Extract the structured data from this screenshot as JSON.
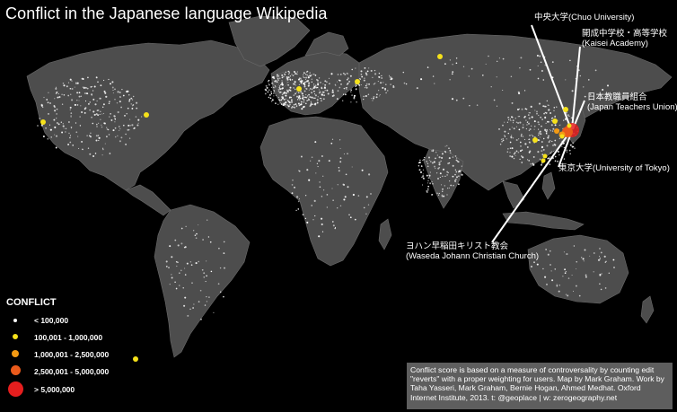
{
  "title": "Conflict in the Japanese language Wikipedia",
  "colors": {
    "background": "#000000",
    "land": "#4d4d4d",
    "borders": "#6f6f6f",
    "activity_dots": "#ffffff",
    "small": "#ffffff",
    "medium": "#f5e11a",
    "large": "#f39a13",
    "xlarge": "#ea5a1b",
    "max": "#e51e1e",
    "caption_bg": "#6e6e6e",
    "callout_line": "#ffffff"
  },
  "callouts": [
    {
      "id": "chuo",
      "label": "中央大学(Chuo University)"
    },
    {
      "id": "kaisei",
      "line1": "開成中学校・高等学校",
      "line2": "(Kaisei Academy)"
    },
    {
      "id": "jtu",
      "line1": "日本教職員組合",
      "line2": "(Japan Teachers Union)"
    },
    {
      "id": "tokyo",
      "label": "東京大学(University of Tokyo)"
    },
    {
      "id": "waseda",
      "line1": "ヨハン早稲田キリスト教会",
      "line2": "(Waseda Johann Christian Church)"
    }
  ],
  "legend": {
    "title": "CONFLICT",
    "items": [
      {
        "label": "< 100,000",
        "color": "#ffffff"
      },
      {
        "label": "100,001 - 1,000,000",
        "color": "#f5e11a"
      },
      {
        "label": "1,000,001 - 2,500,000",
        "color": "#f39a13"
      },
      {
        "label": "2,500,001 - 5,000,000",
        "color": "#ea5a1b"
      },
      {
        "label": "> 5,000,000",
        "color": "#e51e1e"
      }
    ]
  },
  "caption": "Conflict score is based on a measure of controversality by counting edit \"reverts\" with a proper weighting for users. Map by Mark Graham. Work by Taha Yasseri, Mark Graham, Bernie Hogan, Ahmed Medhat. Oxford Internet Institute, 2013. t: @geoplace | w: zerogeography.net"
}
